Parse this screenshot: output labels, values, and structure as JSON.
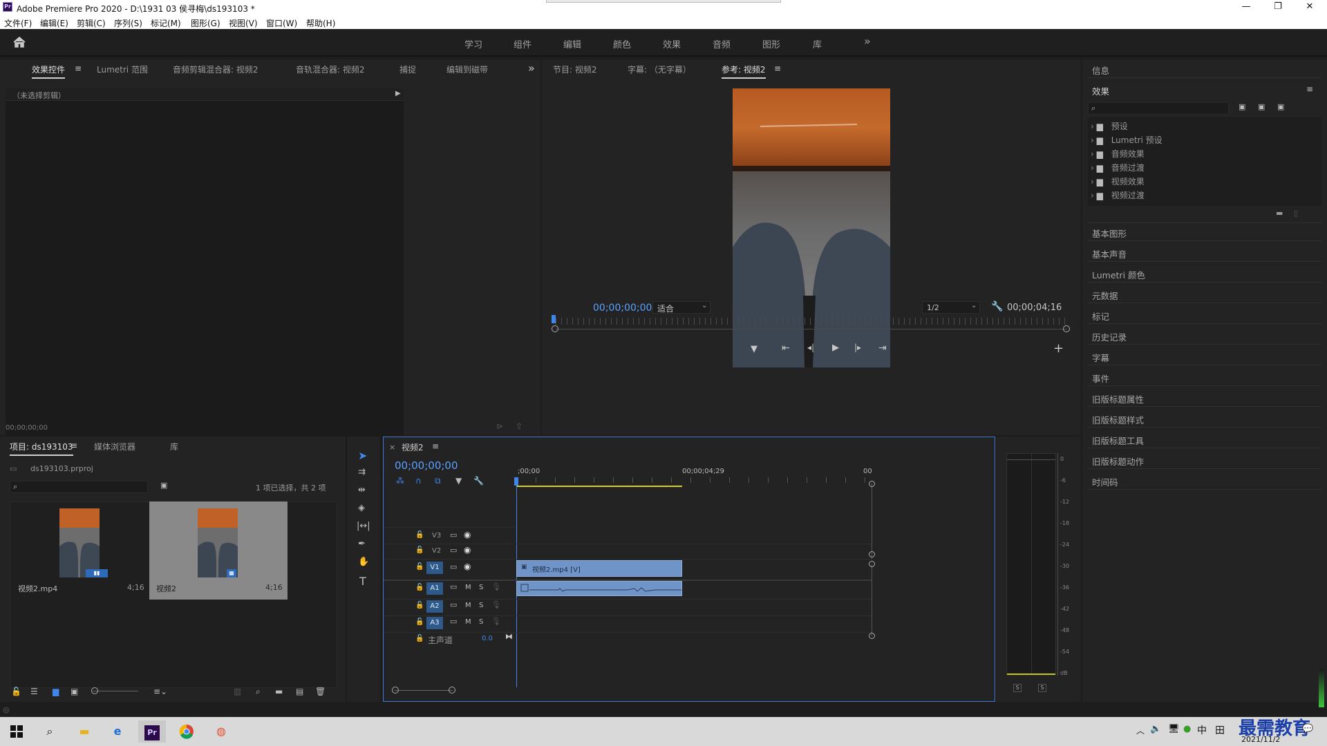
{
  "window": {
    "app_title": "Adobe Premiere Pro 2020 - D:\\1931 03 侯寻梅\\ds193103 *",
    "logo_text": "Pr",
    "minimize": "—",
    "maximize": "❐",
    "close": "✕"
  },
  "menu": [
    "文件(F)",
    "编辑(E)",
    "剪辑(C)",
    "序列(S)",
    "标记(M)",
    "图形(G)",
    "视图(V)",
    "窗口(W)",
    "帮助(H)"
  ],
  "workspaces": [
    "学习",
    "组件",
    "编辑",
    "颜色",
    "效果",
    "音频",
    "图形",
    "库"
  ],
  "workspace_more": "»",
  "effect_controls": {
    "tabs": [
      "效果控件",
      "Lumetri 范围",
      "音频剪辑混合器: 视频2",
      "音轨混合器: 视频2",
      "捕捉",
      "编辑到磁带"
    ],
    "more": "»",
    "no_clip": "（未选择剪辑）",
    "timecode": "00;00;00;00"
  },
  "program_monitor": {
    "tabs": [
      "节目: 视频2",
      "字幕: （无字幕）",
      "参考: 视频2"
    ],
    "timecode_left": "00;00;00;00",
    "fit": "适合",
    "resolution": "1/2",
    "timecode_right": "00;00;04;16",
    "add": "+"
  },
  "right_panel": {
    "info": "信息",
    "effects_title": "效果",
    "effects_tree": [
      "预设",
      "Lumetri 预设",
      "音频效果",
      "音频过渡",
      "视频效果",
      "视频过渡"
    ],
    "sections": [
      "基本图形",
      "基本声音",
      "Lumetri 颜色",
      "元数据",
      "标记",
      "历史记录",
      "字幕",
      "事件",
      "旧版标题属性",
      "旧版标题样式",
      "旧版标题工具",
      "旧版标题动作",
      "时间码"
    ]
  },
  "project": {
    "tabs": [
      "项目: ds193103",
      "媒体浏览器",
      "库"
    ],
    "file": "ds193103.prproj",
    "selection": "1 项已选择，共 2 项",
    "items": [
      {
        "name": "视频2.mp4",
        "duration": "4;16"
      },
      {
        "name": "视频2",
        "duration": "4;16"
      }
    ]
  },
  "timeline": {
    "tab": "视频2",
    "close": "×",
    "timecode": "00;00;00;00",
    "ruler": [
      ";00;00",
      "00;00;04;29",
      "00"
    ],
    "video_tracks": [
      "V3",
      "V2",
      "V1"
    ],
    "audio_tracks": [
      "A1",
      "A2",
      "A3"
    ],
    "mute": "M",
    "solo": "S",
    "master": "主声道",
    "master_value": "0.0",
    "video_clip": "视频2.mp4 [V]"
  },
  "meter": {
    "scale": [
      "0",
      "-6",
      "-12",
      "-18",
      "-24",
      "-30",
      "-36",
      "-42",
      "-48",
      "-54",
      "dB"
    ],
    "solo_left": "S",
    "solo_right": "S"
  },
  "taskbar": {
    "time": "",
    "date": "2021/11/2",
    "ime": "中",
    "watermark": "最需教育"
  },
  "colors": {
    "accent_blue": "#3c7bd6",
    "timecode_blue": "#5aa0ff",
    "clip_blue": "#6f95c8",
    "work_area_yellow": "#d6d01c"
  }
}
